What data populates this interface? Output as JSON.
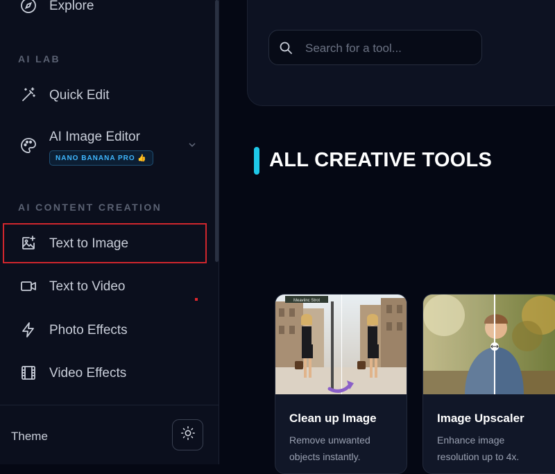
{
  "sidebar": {
    "explore_label": "Explore",
    "sections": {
      "ai_lab": "AI LAB",
      "ai_content_creation": "AI CONTENT CREATION"
    },
    "items": [
      {
        "label": "Quick Edit",
        "icon": "magic-wand-icon"
      },
      {
        "label": "AI Image Editor",
        "icon": "palette-icon",
        "badge": "NANO BANANA PRO 👍"
      },
      {
        "label": "Text to Image",
        "icon": "image-plus-icon",
        "selected": true
      },
      {
        "label": "Text to Video",
        "icon": "video-camera-icon"
      },
      {
        "label": "Photo Effects",
        "icon": "lightning-icon"
      },
      {
        "label": "Video Effects",
        "icon": "film-icon"
      }
    ],
    "theme_label": "Theme"
  },
  "search": {
    "placeholder": "Search for a tool..."
  },
  "main": {
    "section_title": "ALL CREATIVE TOOLS",
    "cards": [
      {
        "title": "Clean up Image",
        "description": "Remove unwanted objects instantly.",
        "image_caption": "Meaviinc Strot"
      },
      {
        "title": "Image Upscaler",
        "description": "Enhance image resolution up to 4x."
      }
    ]
  },
  "colors": {
    "accent": "#1ec8e8",
    "badge_text": "#3fb7ff",
    "highlight": "#d0262d",
    "background": "#050814",
    "sidebar": "#0b0f1d"
  }
}
